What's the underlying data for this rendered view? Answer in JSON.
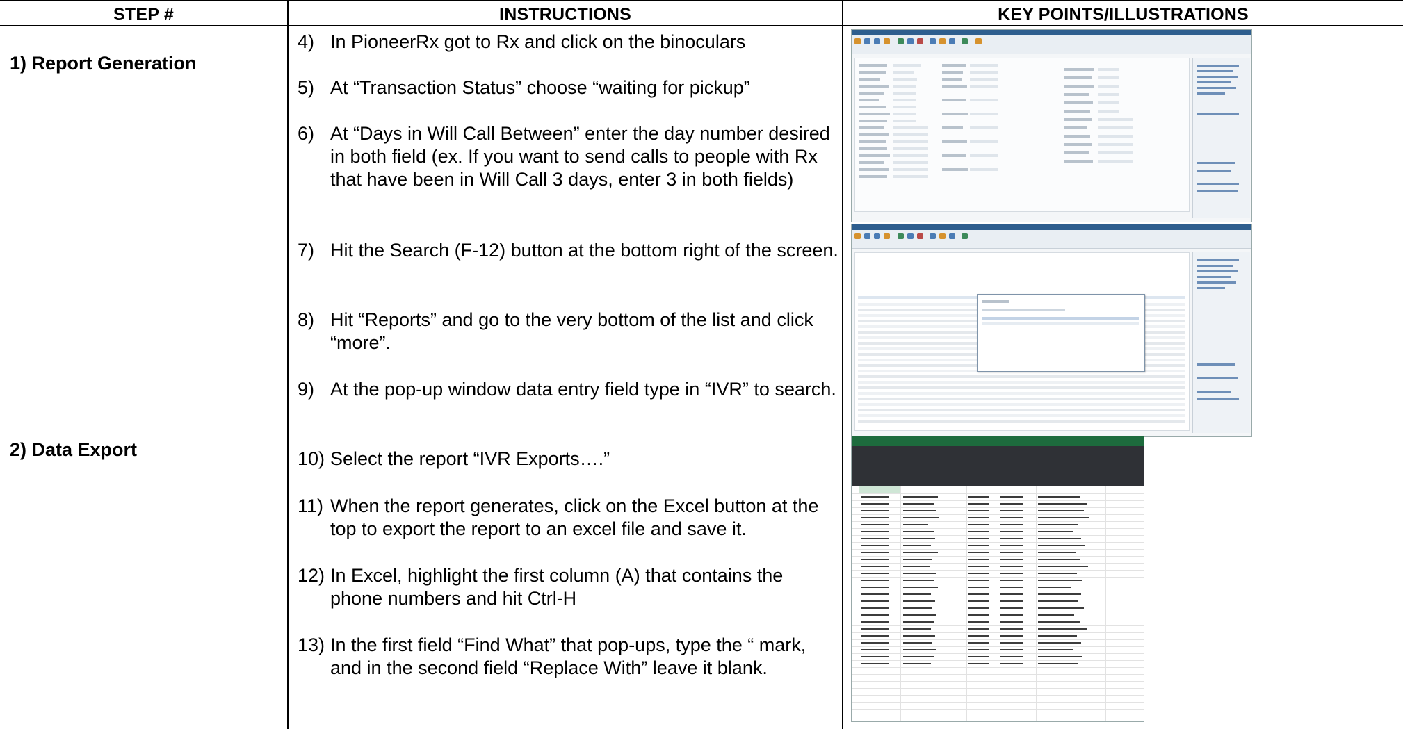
{
  "headers": {
    "step": "STEP #",
    "instructions": "INSTRUCTIONS",
    "key_points": "KEY POINTS/ILLUSTRATIONS"
  },
  "sections": [
    {
      "label": "1)  Report Generation"
    },
    {
      "label": "2)  Data Export"
    }
  ],
  "instructions": [
    {
      "num": "4)",
      "text": "In PioneerRx got to Rx and click on the binoculars"
    },
    {
      "num": "5)",
      "text": "At “Transaction Status” choose “waiting for pickup”"
    },
    {
      "num": "6)",
      "text": "At “Days in Will Call Between” enter the day number desired in both field (ex. If you want to send calls to people with Rx that have been in Will Call 3 days, enter 3 in both fields)"
    },
    {
      "num": "7)",
      "text": "Hit the Search (F-12) button at the bottom right of the screen."
    },
    {
      "num": "8)",
      "text": "Hit “Reports” and go to the very bottom of the list and click “more”."
    },
    {
      "num": "9)",
      "text": "At the pop-up window data entry field type in “IVR” to search."
    },
    {
      "num": "10)",
      "text": "Select the report “IVR Exports….”"
    },
    {
      "num": "11)",
      "text": "When the report generates, click on the Excel button at the top to export the report to an excel file and save it."
    },
    {
      "num": "12)",
      "text": "In Excel, highlight the first column (A) that contains the phone numbers and hit Ctrl-H"
    },
    {
      "num": "13)",
      "text": "In the first field “Find What” that pop-ups, type the “ mark, and in the second field “Replace With” leave it blank."
    }
  ],
  "illustrations": [
    {
      "icon": "pioneerrx-search-screenshot-icon"
    },
    {
      "icon": "pioneerrx-results-report-screenshot-icon"
    },
    {
      "icon": "excel-export-screenshot-icon"
    }
  ]
}
